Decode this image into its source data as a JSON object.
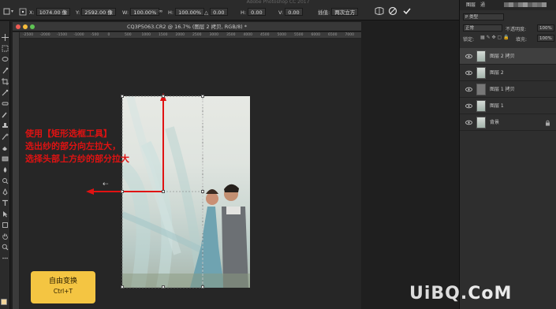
{
  "app_title": "Adobe Photoshop CC 2017",
  "options": {
    "x_label": "X:",
    "x_value": "1074.00 像",
    "y_label": "Y:",
    "y_value": "2592.00 像",
    "w_label": "W:",
    "w_value": "100.00%",
    "h_label": "H:",
    "h_value": "100.00%",
    "angle_value": "0.00",
    "hskew_label": "H:",
    "hskew_value": "0.00",
    "vskew_label": "V:",
    "vskew_value": "0.00",
    "interp_label": "插值:",
    "interp_value": "两次立方"
  },
  "document": {
    "title": "CQ3P5063.CR2 @ 16.7% (图层 2 拷贝, RGB/8) *",
    "ruler_marks": [
      "-2500",
      "-2000",
      "-1500",
      "-1000",
      "-500",
      "0",
      "500",
      "1000",
      "1500",
      "2000",
      "2500",
      "3000",
      "3500",
      "4000",
      "4500",
      "5000",
      "5500",
      "6000",
      "6500",
      "7000"
    ]
  },
  "annotation": {
    "line1": "使用【矩形选框工具】",
    "line2": "选出纱的部分向左拉大，",
    "line3": "选择头部上方纱的部分拉大"
  },
  "shortcut_badge": {
    "title": "自由变换",
    "keys": "Ctrl+T"
  },
  "panel": {
    "tab_layers": "图层",
    "tab_channels": "通",
    "kind_label": "P 类型",
    "blend_mode": "正常",
    "opacity_label": "不透明度:",
    "opacity_value": "100%",
    "lock_label": "锁定:",
    "fill_label": "填充:",
    "fill_value": "100%",
    "layers": [
      {
        "name": "图层 2 拷贝",
        "selected": true
      },
      {
        "name": "图层 2",
        "selected": false
      },
      {
        "name": "图层 1 拷贝",
        "selected": false
      },
      {
        "name": "图层 1",
        "selected": false
      },
      {
        "name": "背景",
        "selected": false
      }
    ]
  },
  "watermark": {
    "text1": "UiBQ.",
    "text2": "CoM"
  },
  "colors": {
    "annotation_red": "#e01212",
    "badge_yellow": "#f4c542",
    "panel_bg": "#2e2e2e"
  }
}
